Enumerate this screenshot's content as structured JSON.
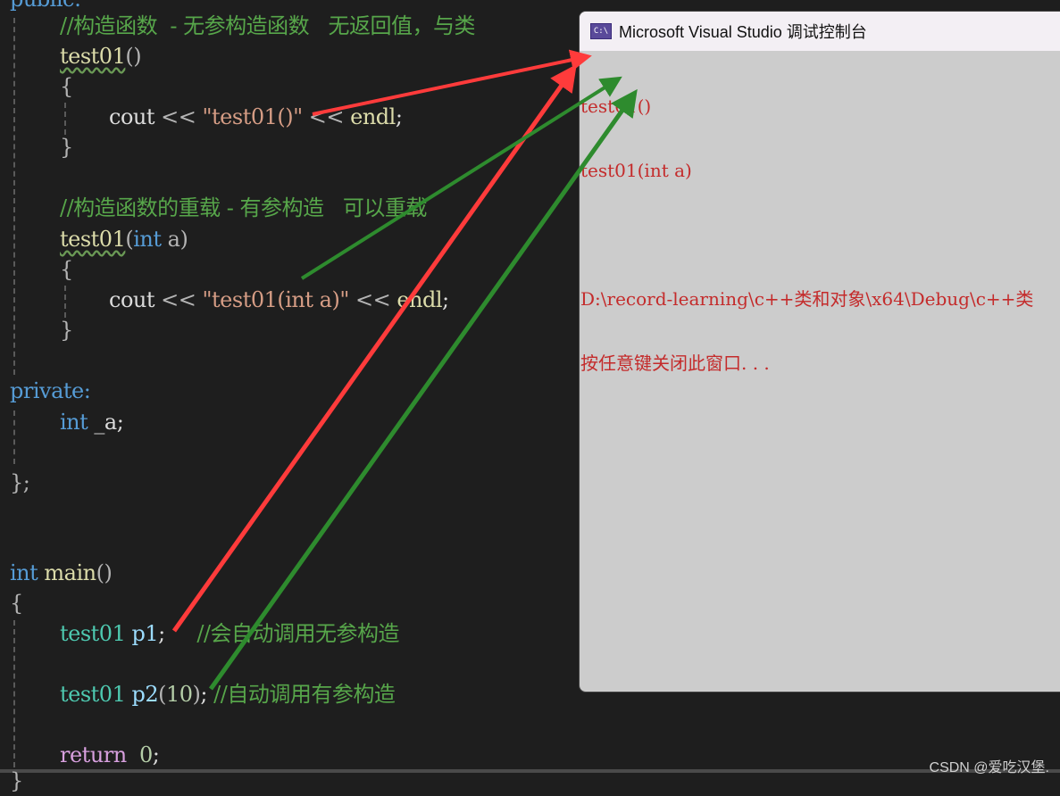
{
  "editor": {
    "lines": {
      "public_kw": "public:",
      "comment1": "//构造函数  - 无参构造函数   无返回值，与类",
      "ctor1_name": "test01",
      "ctor1_parens": "()",
      "brace_open1": "{",
      "cout1_cout": "cout",
      "cout1_op1": " << ",
      "cout1_str": "\"test01()\"",
      "cout1_op2": " << ",
      "cout1_endl": "endl",
      "cout1_semi": ";",
      "brace_close1": "}",
      "comment2": "//构造函数的重载 - 有参构造   可以重载",
      "ctor2_name": "test01",
      "ctor2_lparen": "(",
      "ctor2_int": "int",
      "ctor2_param": " a",
      "ctor2_rparen": ")",
      "brace_open2": "{",
      "cout2_cout": "cout",
      "cout2_op1": " << ",
      "cout2_str": "\"test01(int a)\"",
      "cout2_op2": " << ",
      "cout2_endl": "endl",
      "cout2_semi": ";",
      "brace_close2": "}",
      "private_kw": "private:",
      "member_int": "int",
      "member_name": " _a;",
      "class_end": "};",
      "main_int": "int",
      "main_name": " main",
      "main_parens": "()",
      "main_brace_open": "{",
      "p1_type": "test01",
      "p1_var": " p1",
      "p1_semi": ";",
      "p1_comment": "     //会自动调用无参构造",
      "p2_type": "test01",
      "p2_var": " p2",
      "p2_args_open": "(",
      "p2_num": "10",
      "p2_args_close": ")",
      "p2_semi": ";",
      "p2_comment": " //自动调用有参构造",
      "return_kw": "return",
      "return_val": "  0",
      "return_semi": ";",
      "main_brace_close": "}"
    }
  },
  "console": {
    "title": "Microsoft Visual Studio 调试控制台",
    "icon_label": "C:\\",
    "output_lines": [
      "test01()",
      "test01(int a)",
      "",
      "D:\\record-learning\\c++类和对象\\x64\\Debug\\c++类",
      "按任意键关闭此窗口. . ."
    ]
  },
  "annotations": {
    "red_color": "#ff3b3b",
    "green_color": "#2e8b2e"
  },
  "watermark": "CSDN @爱吃汉堡."
}
